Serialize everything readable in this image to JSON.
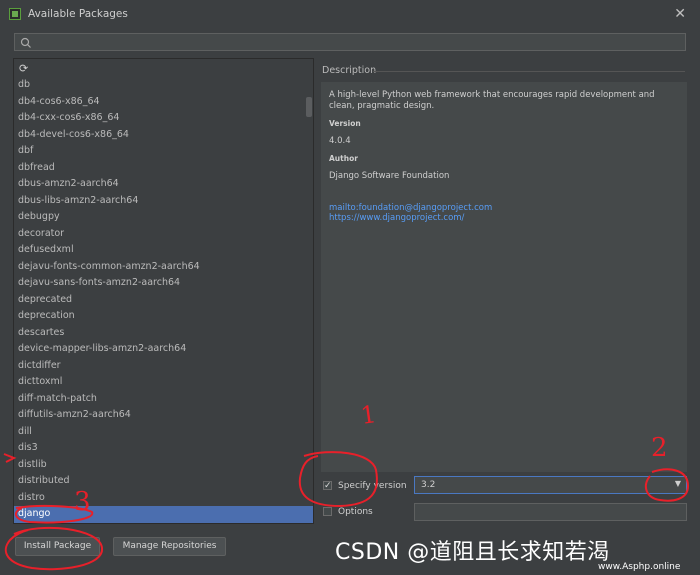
{
  "window": {
    "title": "Available Packages",
    "close_glyph": "✕"
  },
  "search": {
    "placeholder": "",
    "value": ""
  },
  "packages": {
    "refresh_icon": "refresh-icon",
    "items": [
      "db",
      "db4-cos6-x86_64",
      "db4-cxx-cos6-x86_64",
      "db4-devel-cos6-x86_64",
      "dbf",
      "dbfread",
      "dbus-amzn2-aarch64",
      "dbus-libs-amzn2-aarch64",
      "debugpy",
      "decorator",
      "defusedxml",
      "dejavu-fonts-common-amzn2-aarch64",
      "dejavu-sans-fonts-amzn2-aarch64",
      "deprecated",
      "deprecation",
      "descartes",
      "device-mapper-libs-amzn2-aarch64",
      "dictdiffer",
      "dicttoxml",
      "diff-match-patch",
      "diffutils-amzn2-aarch64",
      "dill",
      "dis3",
      "distlib",
      "distributed",
      "distro",
      "django"
    ],
    "selected": "django"
  },
  "description": {
    "title": "Description",
    "summary": "A high-level Python web framework that encourages rapid development and clean, pragmatic design.",
    "version_label": "Version",
    "version": "4.0.4",
    "author_label": "Author",
    "author": "Django Software Foundation",
    "email_link": "mailto:foundation@djangoproject.com",
    "site_link": "https://www.djangoproject.com/"
  },
  "options": {
    "specify_version_label": "Specify version",
    "specify_version_checked": true,
    "version_value": "3.2",
    "options_label": "Options",
    "options_checked": false,
    "options_value": ""
  },
  "buttons": {
    "install": "Install Package",
    "manage": "Manage Repositories"
  },
  "annotations": {
    "one": "1",
    "two": "2",
    "three": "3"
  },
  "watermark": {
    "text": "CSDN @道阻且长求知若渴",
    "site": "www.Asphp.online"
  },
  "colors": {
    "selection": "#4b6eaf",
    "link": "#589df6",
    "annotation": "#e8202a"
  }
}
